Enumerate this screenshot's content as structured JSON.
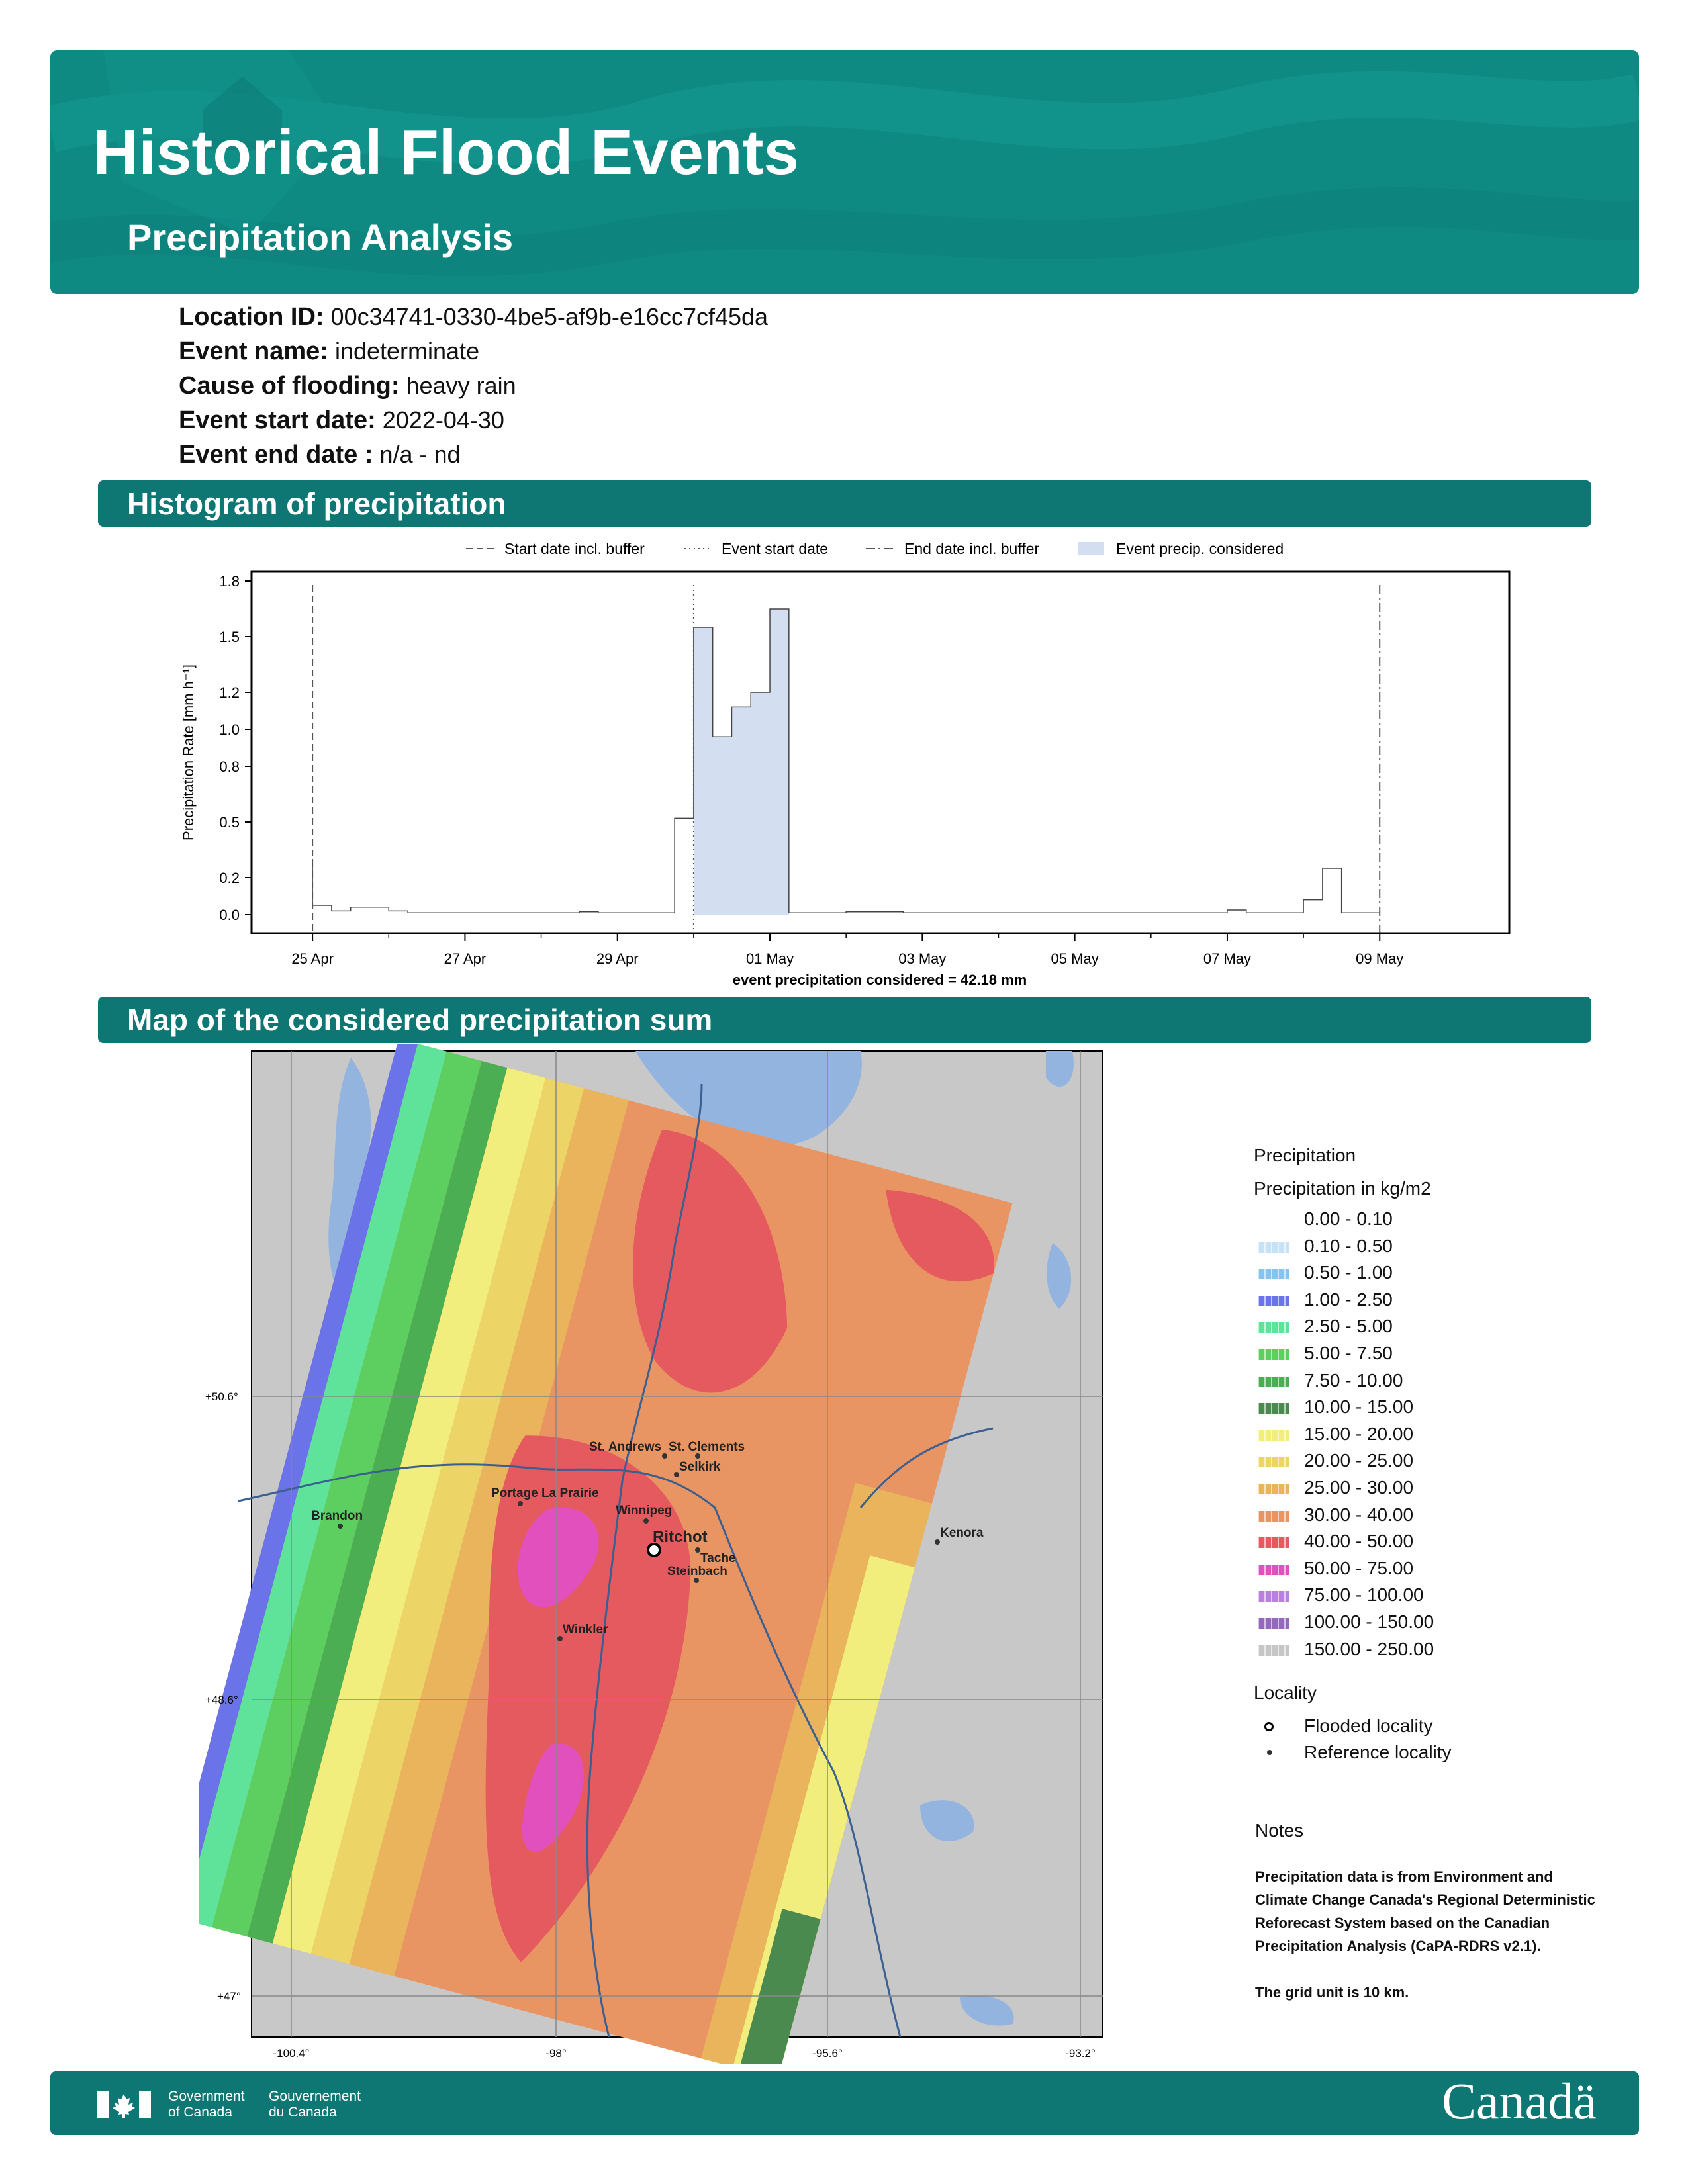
{
  "header": {
    "title": "Historical Flood Events",
    "subtitle": "Precipitation Analysis"
  },
  "event_info": [
    {
      "label": "Location ID:",
      "value": "00c34741-0330-4be5-af9b-e16cc7cf45da"
    },
    {
      "label": "Event name:",
      "value": "indeterminate"
    },
    {
      "label": "Cause of flooding:",
      "value": "heavy rain"
    },
    {
      "label": "Event start date:",
      "value": "2022-04-30"
    },
    {
      "label": "Event end date :",
      "value": "n/a - nd"
    }
  ],
  "sections": {
    "histogram": "Histogram of precipitation",
    "map": "Map of the considered precipitation sum"
  },
  "chart_data": {
    "type": "area",
    "ylabel": "Precipitation Rate [mm h⁻¹]",
    "ylim": [
      -0.1,
      1.85
    ],
    "yticks": [
      0.0,
      0.2,
      0.5,
      0.8,
      1.0,
      1.2,
      1.5,
      1.8
    ],
    "xticks": [
      "25 Apr",
      "27 Apr",
      "29 Apr",
      "01 May",
      "03 May",
      "05 May",
      "07 May",
      "09 May"
    ],
    "xtick_days": [
      0,
      2,
      4,
      6,
      8,
      10,
      12,
      14
    ],
    "xlim_days": [
      -0.8,
      15.7
    ],
    "legend": {
      "start_buffer": "Start date incl. buffer",
      "event_start": "Event start date",
      "end_buffer": "End date incl. buffer",
      "considered": "Event precip. considered"
    },
    "start_buffer_day": 0,
    "event_start_day": 5.0,
    "end_buffer_day": 14.0,
    "considered_range_days": [
      5.0,
      6.25
    ],
    "steps": [
      {
        "x": 0.0,
        "y": 0.05
      },
      {
        "x": 0.25,
        "y": 0.02
      },
      {
        "x": 0.5,
        "y": 0.04
      },
      {
        "x": 1.0,
        "y": 0.02
      },
      {
        "x": 1.25,
        "y": 0.01
      },
      {
        "x": 3.5,
        "y": 0.015
      },
      {
        "x": 3.75,
        "y": 0.01
      },
      {
        "x": 4.75,
        "y": 0.52
      },
      {
        "x": 5.0,
        "y": 1.55
      },
      {
        "x": 5.25,
        "y": 0.96
      },
      {
        "x": 5.5,
        "y": 1.12
      },
      {
        "x": 5.75,
        "y": 1.2
      },
      {
        "x": 6.0,
        "y": 1.65
      },
      {
        "x": 6.25,
        "y": 0.01
      },
      {
        "x": 7.0,
        "y": 0.015
      },
      {
        "x": 7.75,
        "y": 0.01
      },
      {
        "x": 12.0,
        "y": 0.025
      },
      {
        "x": 12.25,
        "y": 0.01
      },
      {
        "x": 13.0,
        "y": 0.08
      },
      {
        "x": 13.25,
        "y": 0.25
      },
      {
        "x": 13.5,
        "y": 0.01
      },
      {
        "x": 14.0,
        "y": 0.01
      }
    ],
    "footnote": "event precipitation considered = 42.18 mm"
  },
  "map": {
    "lon_ticks": [
      "-100.4°",
      "-98°",
      "-95.6°",
      "-93.2°"
    ],
    "lat_ticks": [
      "+50.6°",
      "+48.6°",
      "+47°"
    ],
    "places": [
      {
        "name": "Ritchot",
        "kind": "flooded"
      },
      {
        "name": "Brandon",
        "kind": "reference"
      },
      {
        "name": "Portage La Prairie",
        "kind": "reference"
      },
      {
        "name": "Winnipeg",
        "kind": "reference"
      },
      {
        "name": "St. Andrews",
        "kind": "reference"
      },
      {
        "name": "St. Clements",
        "kind": "reference"
      },
      {
        "name": "Selkirk",
        "kind": "reference"
      },
      {
        "name": "Tache",
        "kind": "reference"
      },
      {
        "name": "Steinbach",
        "kind": "reference"
      },
      {
        "name": "Winkler",
        "kind": "reference"
      },
      {
        "name": "Kenora",
        "kind": "reference"
      }
    ]
  },
  "legend": {
    "title": "Precipitation",
    "subtitle": "Precipitation in kg/m2",
    "classes": [
      {
        "label": "0.00 - 0.10",
        "color": "#ffffff"
      },
      {
        "label": "0.10 - 0.50",
        "color": "#c6e2f5"
      },
      {
        "label": "0.50 - 1.00",
        "color": "#87c3ef"
      },
      {
        "label": "1.00 - 2.50",
        "color": "#6a74e8"
      },
      {
        "label": "2.50 - 5.00",
        "color": "#5fe39a"
      },
      {
        "label": "5.00 - 7.50",
        "color": "#5ccf60"
      },
      {
        "label": "7.50 - 10.00",
        "color": "#4cae53"
      },
      {
        "label": "10.00 - 15.00",
        "color": "#4a8a4e"
      },
      {
        "label": "15.00 - 20.00",
        "color": "#f2ee7e"
      },
      {
        "label": "20.00 - 25.00",
        "color": "#ecd566"
      },
      {
        "label": "25.00 - 30.00",
        "color": "#eab45c"
      },
      {
        "label": "30.00 - 40.00",
        "color": "#e99463"
      },
      {
        "label": "40.00 - 50.00",
        "color": "#e55a5f"
      },
      {
        "label": "50.00 - 75.00",
        "color": "#e250be"
      },
      {
        "label": "75.00 - 100.00",
        "color": "#b880df"
      },
      {
        "label": "100.00 - 150.00",
        "color": "#9469bd"
      },
      {
        "label": "150.00 - 250.00",
        "color": "#c6c6c6"
      }
    ],
    "locality_title": "Locality",
    "flooded": "Flooded locality",
    "reference": "Reference locality"
  },
  "notes": {
    "title": "Notes",
    "line1": "Precipitation data is from Environment and Climate Change Canada's Regional Deterministic Reforecast System based on the Canadian Precipitation Analysis (CaPA-RDRS v2.1).",
    "line2": "The grid unit is 10 km."
  },
  "footer": {
    "gov_en_1": "Government",
    "gov_en_2": "of Canada",
    "gov_fr_1": "Gouvernement",
    "gov_fr_2": "du Canada",
    "wordmark": "Canadä"
  }
}
